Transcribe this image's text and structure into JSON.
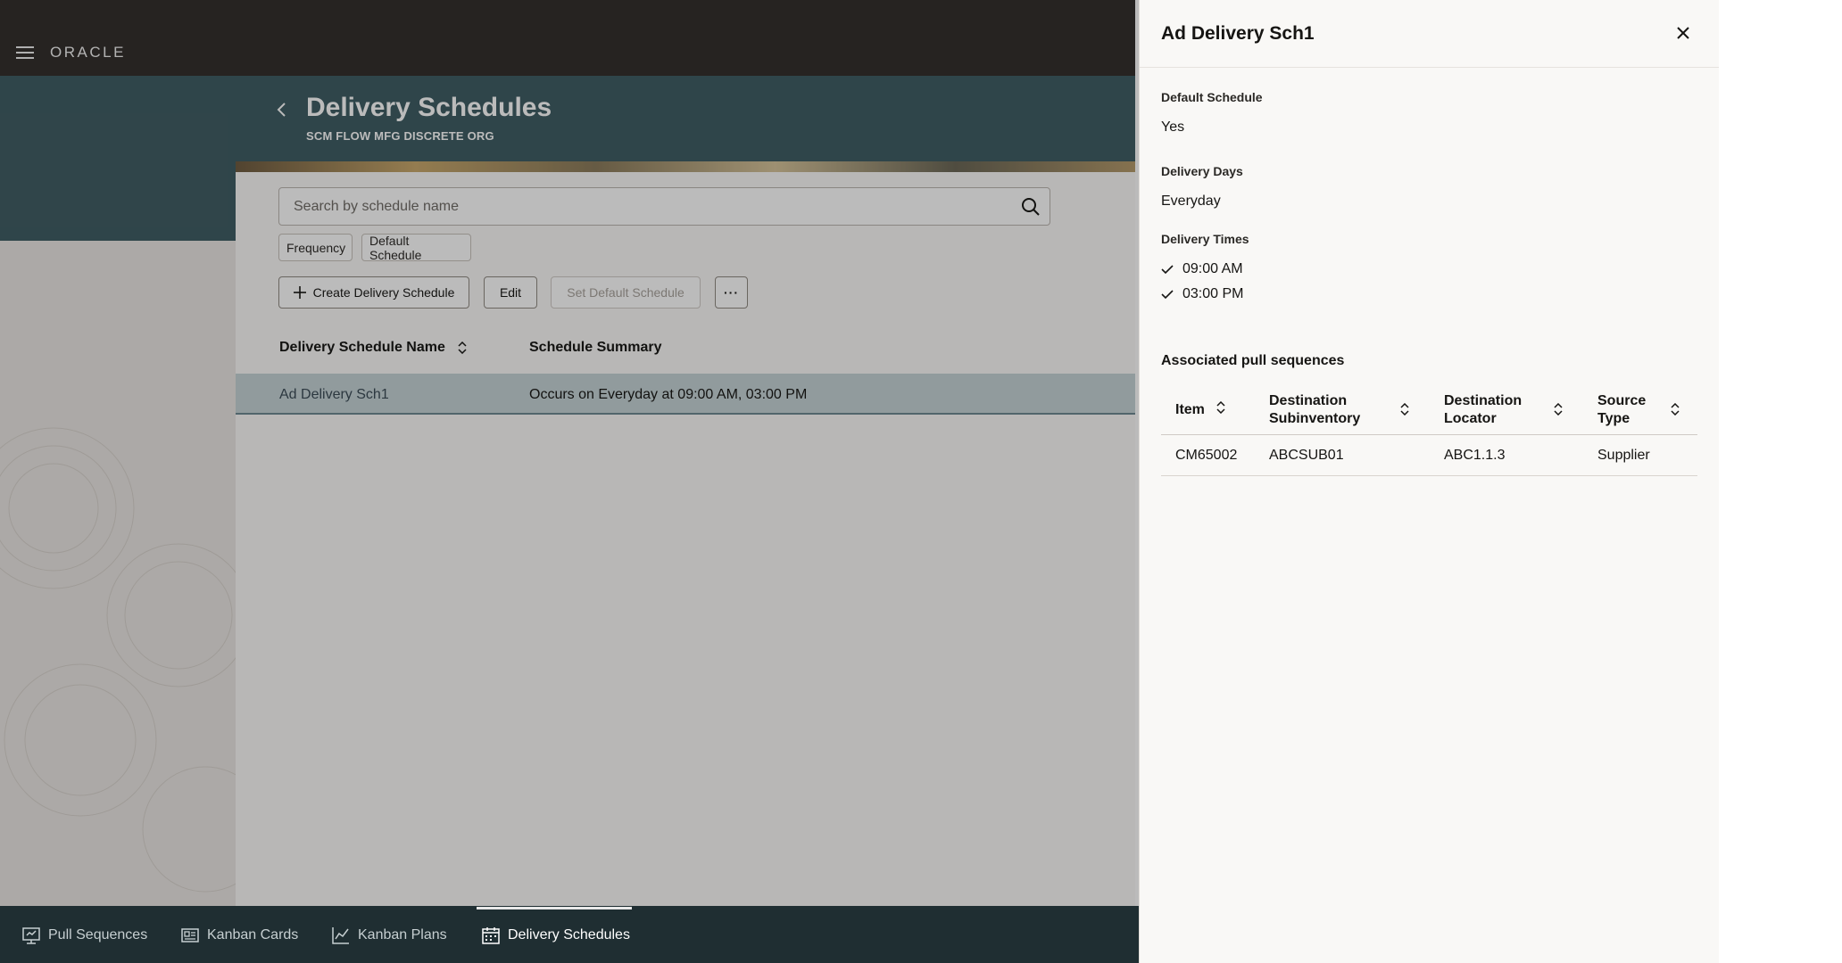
{
  "app": {
    "brand": "ORACLE"
  },
  "page": {
    "title": "Delivery Schedules",
    "subtitle": "SCM FLOW MFG DISCRETE ORG"
  },
  "search": {
    "placeholder": "Search by schedule name"
  },
  "filters": [
    "Frequency",
    "Default Schedule"
  ],
  "toolbar": {
    "create_label": "Create Delivery Schedule",
    "edit_label": "Edit",
    "set_default_label": "Set Default Schedule",
    "more_label": "···"
  },
  "table": {
    "columns": [
      "Delivery Schedule Name",
      "Schedule Summary"
    ],
    "rows": [
      {
        "name": "Ad Delivery Sch1",
        "summary": "Occurs on Everyday at 09:00 AM, 03:00 PM",
        "selected": true
      }
    ]
  },
  "bottom_nav": {
    "items": [
      {
        "label": "Pull Sequences",
        "icon": "pull-sequences-icon",
        "active": false
      },
      {
        "label": "Kanban Cards",
        "icon": "kanban-cards-icon",
        "active": false
      },
      {
        "label": "Kanban Plans",
        "icon": "kanban-plans-icon",
        "active": false
      },
      {
        "label": "Delivery Schedules",
        "icon": "calendar-icon",
        "active": true
      }
    ]
  },
  "drawer": {
    "title": "Ad Delivery Sch1",
    "default_schedule_label": "Default Schedule",
    "default_schedule_value": "Yes",
    "delivery_days_label": "Delivery Days",
    "delivery_days_value": "Everyday",
    "delivery_times_label": "Delivery Times",
    "delivery_times": [
      "09:00 AM",
      "03:00 PM"
    ],
    "section_title": "Associated pull sequences",
    "ps_columns": [
      {
        "line1": "Item",
        "line2": ""
      },
      {
        "line1": "Destination",
        "line2": "Subinventory"
      },
      {
        "line1": "Destination",
        "line2": "Locator"
      },
      {
        "line1": "Source",
        "line2": "Type"
      }
    ],
    "ps_rows": [
      {
        "item": "CM65002",
        "subinventory": "ABCSUB01",
        "locator": "ABC1.1.3",
        "source_type": "Supplier"
      }
    ]
  },
  "colors": {
    "topbar": "#312d2a",
    "header_band": "#3e5c63",
    "selected_row": "#c5d3d6",
    "bottom_nav": "#1f2e32"
  }
}
